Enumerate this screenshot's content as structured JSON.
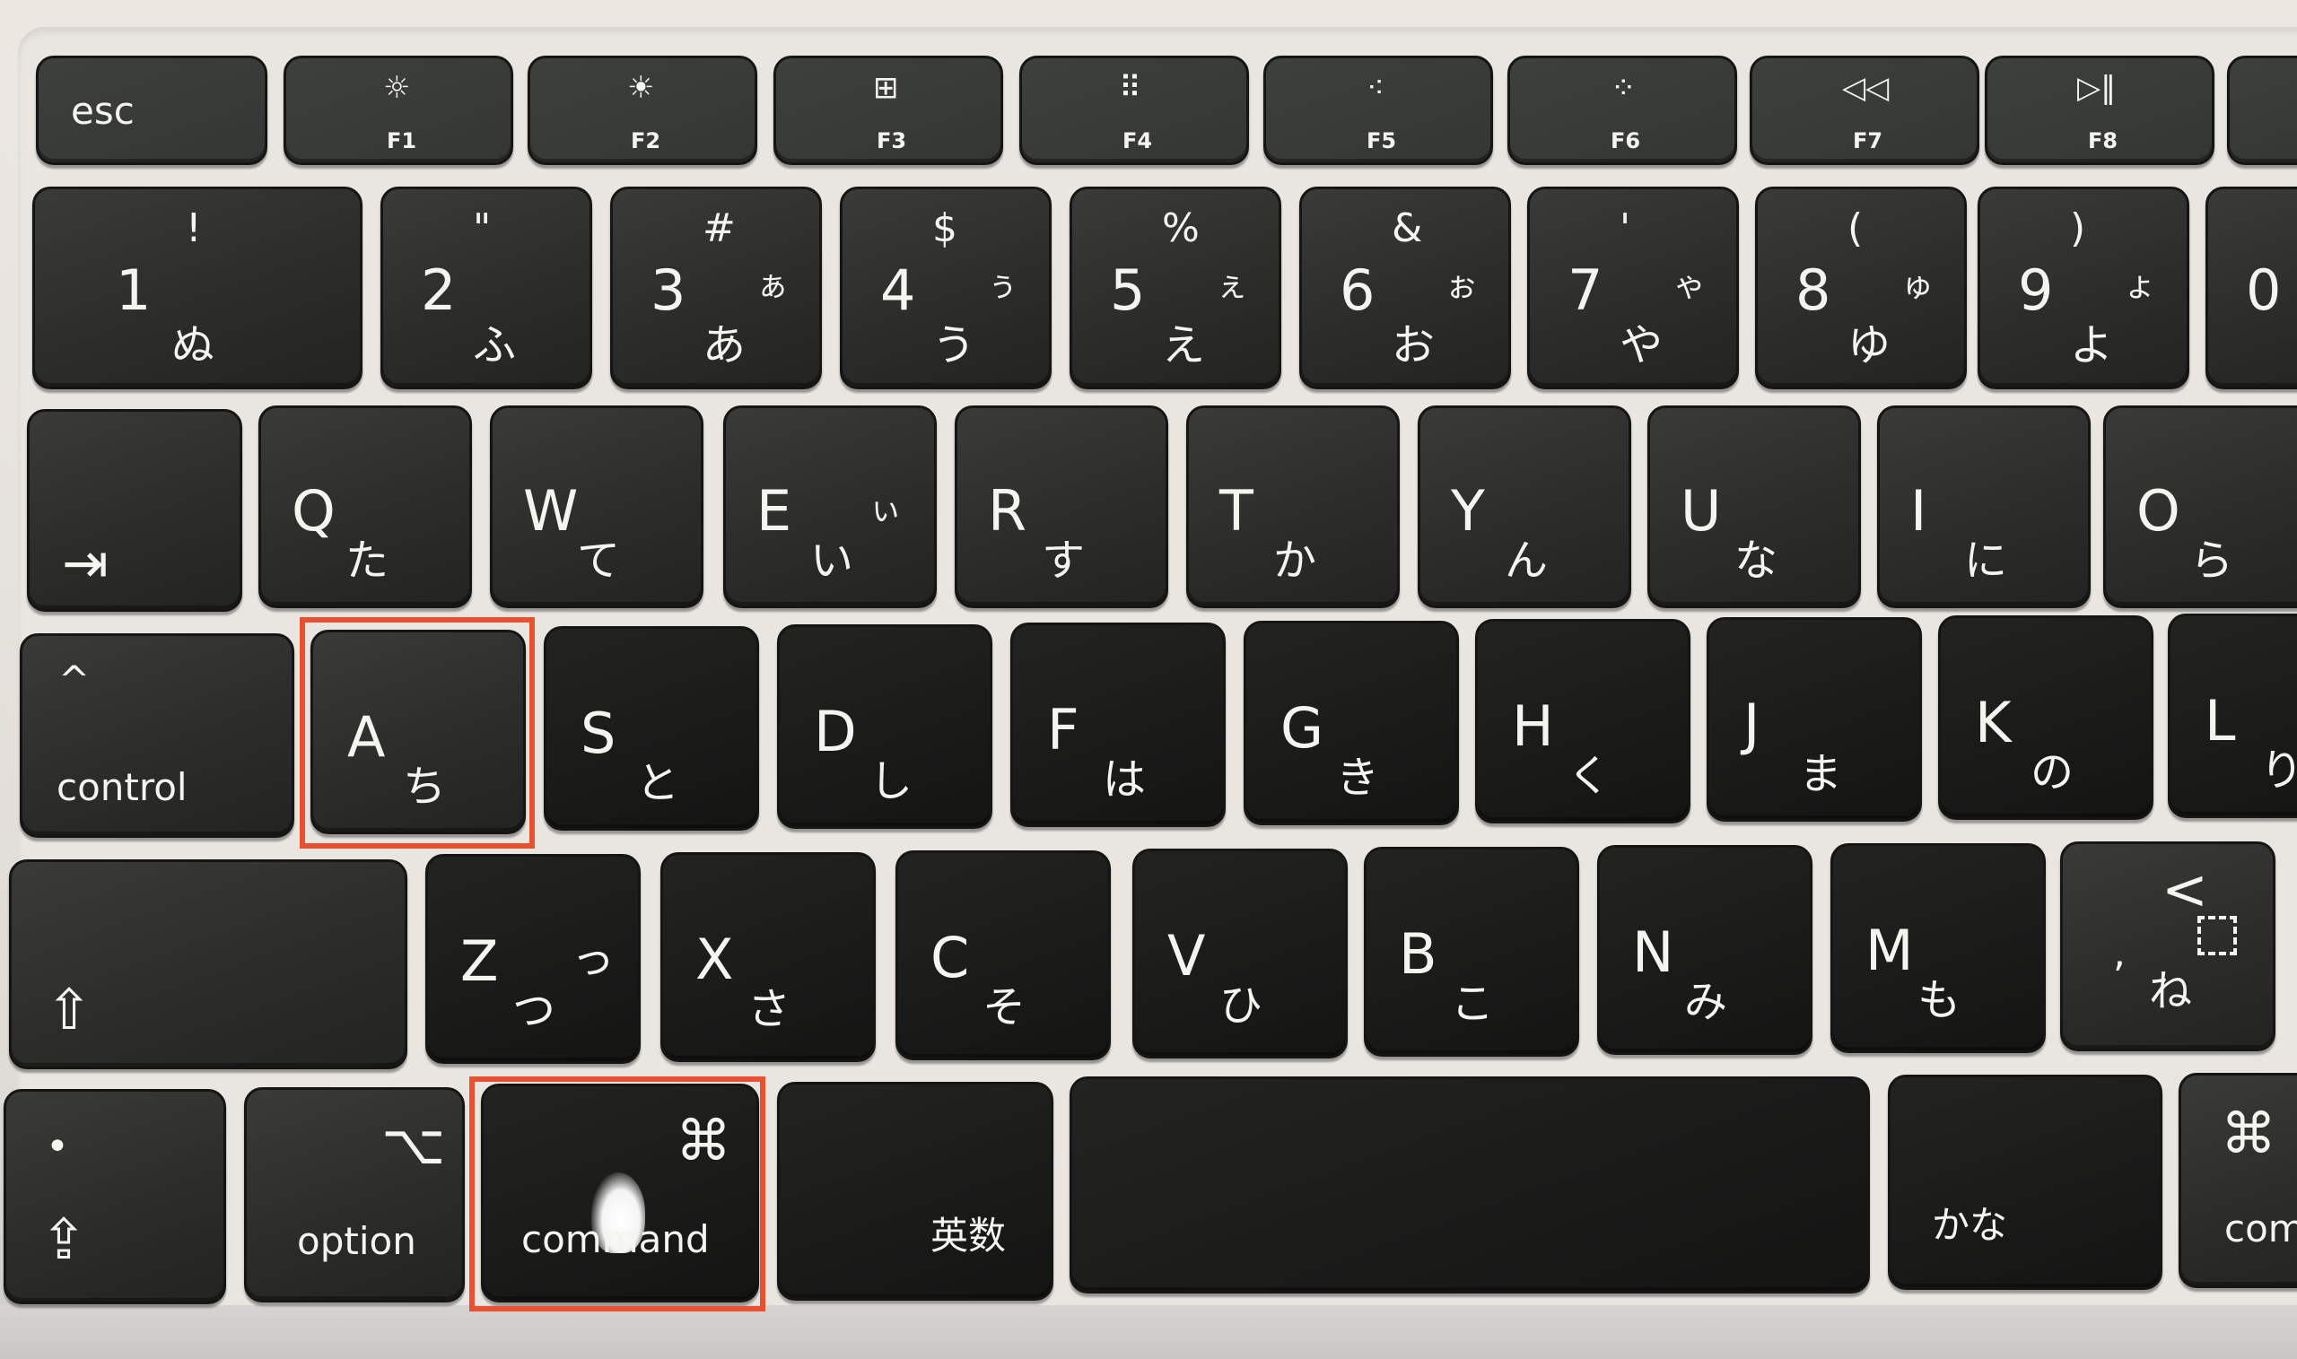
{
  "image": {
    "description": "Close-up photo of a Japanese layout Mac keyboard with the A key and left command key outlined in red",
    "highlight_color": "#e8502f"
  },
  "function_row": [
    {
      "label": "esc",
      "icon": ""
    },
    {
      "label": "F1",
      "icon": "brightness-down-icon",
      "glyph": "☼"
    },
    {
      "label": "F2",
      "icon": "brightness-up-icon",
      "glyph": "☀"
    },
    {
      "label": "F3",
      "icon": "mission-control-icon",
      "glyph": "⊞"
    },
    {
      "label": "F4",
      "icon": "launchpad-icon",
      "glyph": "⠿"
    },
    {
      "label": "F5",
      "icon": "keyboard-backlight-down-icon",
      "glyph": "⁖"
    },
    {
      "label": "F6",
      "icon": "keyboard-backlight-up-icon",
      "glyph": "⁘"
    },
    {
      "label": "F7",
      "icon": "rewind-icon",
      "glyph": "◁◁"
    },
    {
      "label": "F8",
      "icon": "play-pause-icon",
      "glyph": "▷‖"
    }
  ],
  "number_row": [
    {
      "main": "1",
      "shift": "!",
      "kana": "ぬ",
      "small_kana": ""
    },
    {
      "main": "2",
      "shift": "\"",
      "kana": "ふ",
      "small_kana": ""
    },
    {
      "main": "3",
      "shift": "#",
      "kana": "あ",
      "small_kana": "ぁ"
    },
    {
      "main": "4",
      "shift": "$",
      "kana": "う",
      "small_kana": "ぅ"
    },
    {
      "main": "5",
      "shift": "%",
      "kana": "え",
      "small_kana": "ぇ"
    },
    {
      "main": "6",
      "shift": "&",
      "kana": "お",
      "small_kana": "ぉ"
    },
    {
      "main": "7",
      "shift": "'",
      "kana": "や",
      "small_kana": "ゃ"
    },
    {
      "main": "8",
      "shift": "(",
      "kana": "ゆ",
      "small_kana": "ゅ"
    },
    {
      "main": "9",
      "shift": ")",
      "kana": "よ",
      "small_kana": "ょ"
    },
    {
      "main": "0",
      "shift": "",
      "kana": "",
      "small_kana": ""
    }
  ],
  "qwerty_row": {
    "tab_glyph": "⇥",
    "keys": [
      {
        "main": "Q",
        "kana": "た",
        "small_kana": ""
      },
      {
        "main": "W",
        "kana": "て",
        "small_kana": ""
      },
      {
        "main": "E",
        "kana": "い",
        "small_kana": "ぃ"
      },
      {
        "main": "R",
        "kana": "す",
        "small_kana": ""
      },
      {
        "main": "T",
        "kana": "か",
        "small_kana": ""
      },
      {
        "main": "Y",
        "kana": "ん",
        "small_kana": ""
      },
      {
        "main": "U",
        "kana": "な",
        "small_kana": ""
      },
      {
        "main": "I",
        "kana": "に",
        "small_kana": ""
      },
      {
        "main": "O",
        "kana": "ら",
        "small_kana": ""
      }
    ]
  },
  "home_row": {
    "control_label": "control",
    "control_glyph": "^",
    "keys": [
      {
        "main": "A",
        "kana": "ち",
        "highlighted": true
      },
      {
        "main": "S",
        "kana": "と"
      },
      {
        "main": "D",
        "kana": "し"
      },
      {
        "main": "F",
        "kana": "は"
      },
      {
        "main": "G",
        "kana": "き"
      },
      {
        "main": "H",
        "kana": "く"
      },
      {
        "main": "J",
        "kana": "ま"
      },
      {
        "main": "K",
        "kana": "の"
      },
      {
        "main": "L",
        "kana": "り"
      }
    ]
  },
  "shift_row": {
    "shift_glyph": "⇧",
    "keys": [
      {
        "main": "Z",
        "kana": "つ",
        "small_kana": "っ"
      },
      {
        "main": "X",
        "kana": "さ",
        "small_kana": ""
      },
      {
        "main": "C",
        "kana": "そ",
        "small_kana": ""
      },
      {
        "main": "V",
        "kana": "ひ",
        "small_kana": ""
      },
      {
        "main": "B",
        "kana": "こ",
        "small_kana": ""
      },
      {
        "main": "N",
        "kana": "み",
        "small_kana": ""
      },
      {
        "main": "M",
        "kana": "も",
        "small_kana": ""
      },
      {
        "main": ",",
        "shift": "<",
        "kana": "ね",
        "small_kana": "、"
      }
    ]
  },
  "bottom_row": {
    "fn": {
      "glyph_top": "•",
      "glyph_bottom": "⇪"
    },
    "option": {
      "label": "option",
      "glyph": "⌥"
    },
    "command_left": {
      "label": "command",
      "glyph": "⌘",
      "highlighted": true
    },
    "eisu": {
      "label": "英数"
    },
    "space": {
      "label": ""
    },
    "kana": {
      "label": "かな"
    },
    "command_right": {
      "label": "com",
      "glyph": "⌘"
    }
  }
}
